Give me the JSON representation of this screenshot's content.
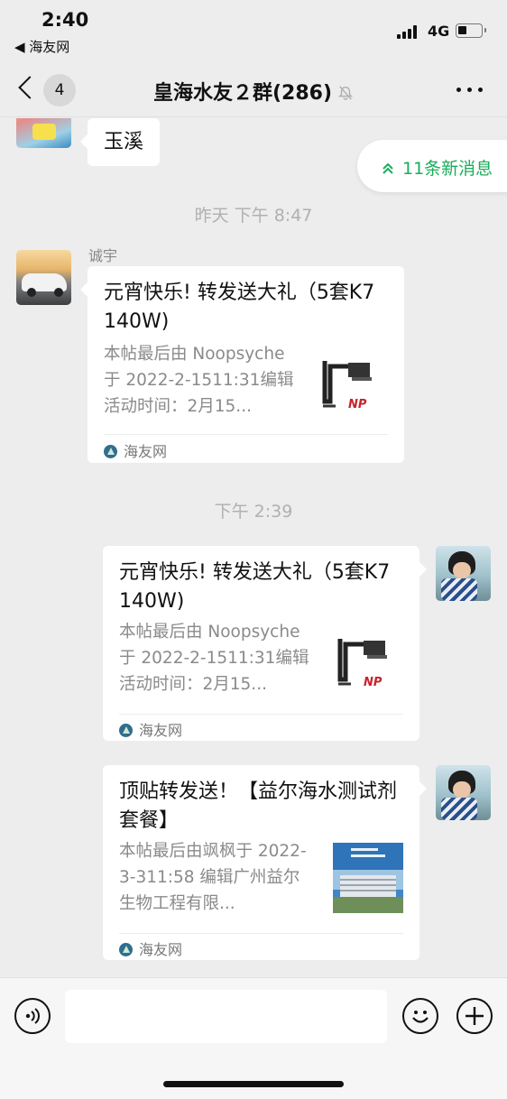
{
  "status_bar": {
    "time": "2:40",
    "back_app": "◀ 海友网",
    "network": "4G"
  },
  "nav": {
    "unread_count": "4",
    "title": "皇海水友２群(286)"
  },
  "new_messages": {
    "label": "11条新消息"
  },
  "messages": {
    "m1": {
      "text": "玉溪"
    },
    "ts1": "昨天 下午 8:47",
    "m2": {
      "sender": "诚宇",
      "title": "元宵快乐! 转发送大礼（5套K7  140W)",
      "desc": "本帖最后由 Noopsyche 于 2022-2-1511:31编辑活动时间：2月15...",
      "thumb_text": "NP",
      "source": "海友网"
    },
    "ts2": "下午 2:39",
    "m3": {
      "title": "元宵快乐! 转发送大礼（5套K7  140W)",
      "desc": "本帖最后由 Noopsyche 于 2022-2-1511:31编辑活动时间：2月15...",
      "thumb_text": "NP",
      "source": "海友网"
    },
    "m4": {
      "title": "顶贴转发送！【益尔海水测试剂套餐】",
      "desc": "本帖最后由飒枫于 2022-3-311:58 编辑广州益尔生物工程有限...",
      "source": "海友网"
    }
  },
  "colors": {
    "accent_green": "#1aad5a",
    "chat_bg": "#ededed"
  }
}
